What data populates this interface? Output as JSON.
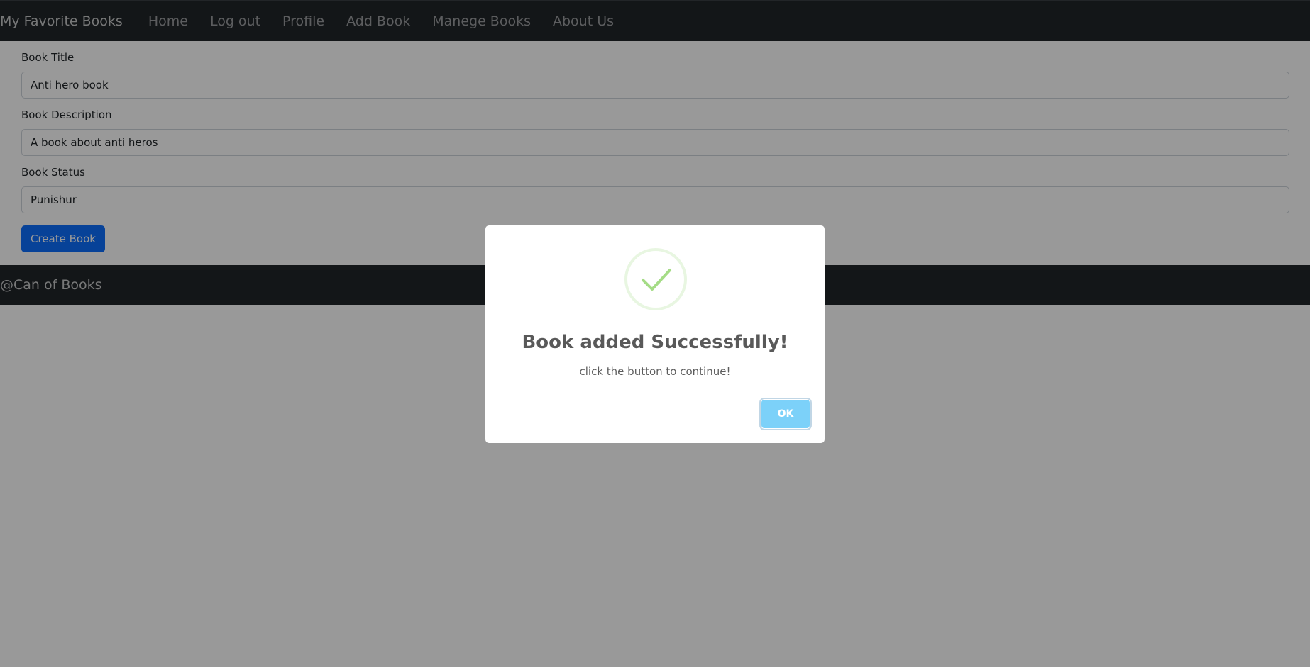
{
  "navbar": {
    "brand": "My Favorite Books",
    "links": [
      "Home",
      "Log out",
      "Profile",
      "Add Book",
      "Manege Books",
      "About Us"
    ]
  },
  "form": {
    "title_label": "Book Title",
    "title_value": "Anti hero book",
    "description_label": "Book Description",
    "description_value": "A book about anti heros",
    "status_label": "Book Status",
    "status_value": "Punishur",
    "submit_label": "Create Book"
  },
  "footer": {
    "text": "@Can of Books"
  },
  "modal": {
    "icon": "checkmark-icon",
    "title": "Book added Successfully!",
    "text": "click the button to continue!",
    "ok_label": "OK"
  },
  "colors": {
    "navbar_bg": "#212529",
    "primary": "#0d6efd",
    "success": "#a5dc86",
    "ok_button": "#7cd1f9"
  }
}
